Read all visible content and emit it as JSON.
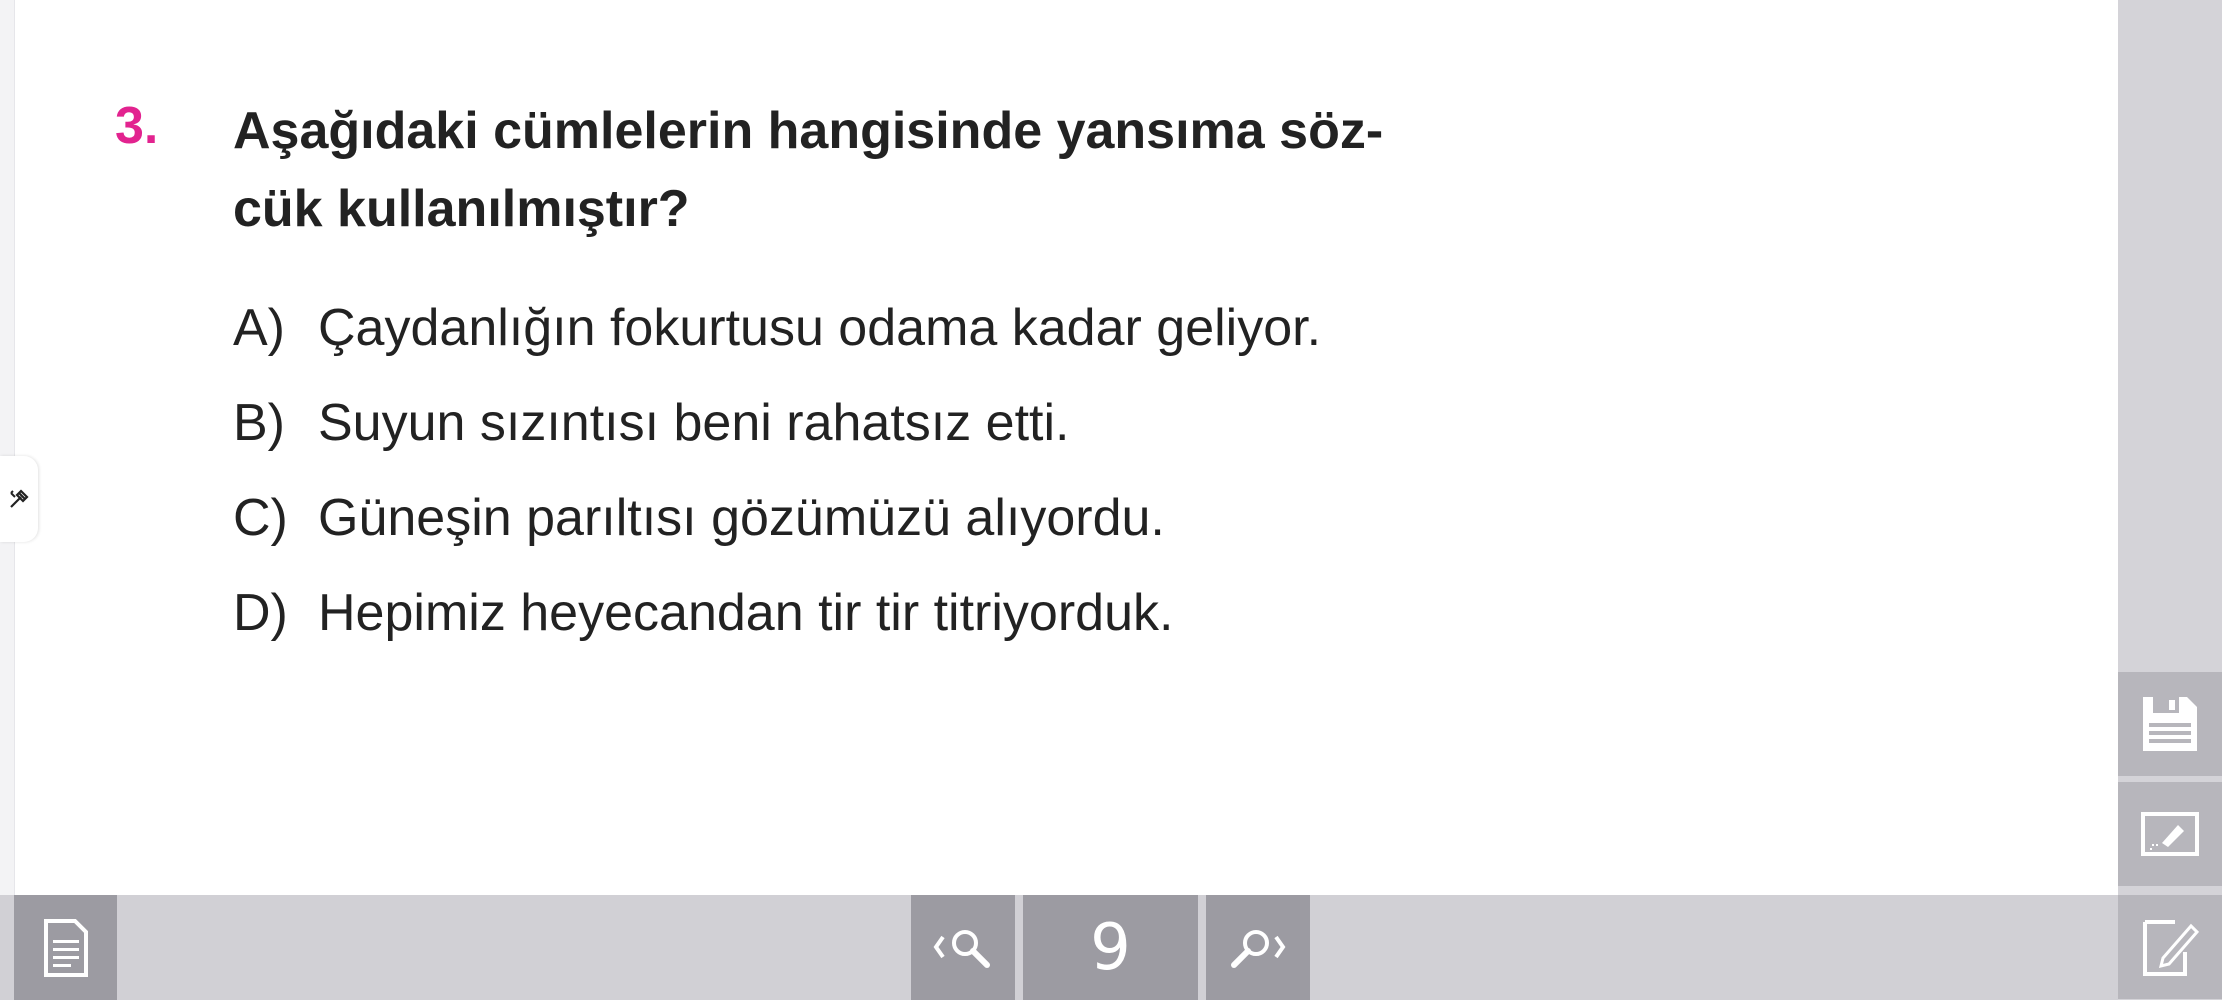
{
  "question": {
    "number": "3.",
    "line1": "Aşağıdaki cümlelerin hangisinde yansıma söz-",
    "line2": "cük kullanılmıştır?"
  },
  "options": [
    {
      "letter": "A)",
      "text": "Çaydanlığın fokurtusu odama kadar geliyor."
    },
    {
      "letter": "B)",
      "text": "Suyun sızıntısı beni rahatsız etti."
    },
    {
      "letter": "C)",
      "text": "Güneşin parıltısı gözümüzü alıyordu."
    },
    {
      "letter": "D)",
      "text": "Hepimiz heyecandan tir tir titriyorduk."
    }
  ],
  "toolbar": {
    "page_number": "9",
    "icons": [
      "page-icon",
      "search-prev-icon",
      "search-next-icon"
    ]
  },
  "side_tools": {
    "icons": [
      "save-icon",
      "screen-capture-icon",
      "edit-note-icon",
      "pen-tool-icon"
    ]
  },
  "colors": {
    "accent": "#e2238f",
    "toolbar_bg": "#d1d0d5",
    "button_bg": "#9c9ba2"
  }
}
